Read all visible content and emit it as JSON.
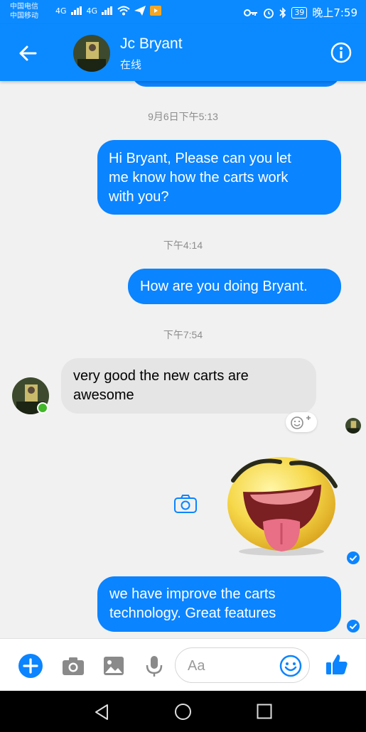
{
  "status_bar": {
    "carrier_1": "中国电信",
    "carrier_2": "中国移动",
    "signal_1": "4G",
    "signal_2": "4G",
    "battery": "39",
    "time": "晚上7:59"
  },
  "header": {
    "contact_name": "Jc Bryant",
    "status": "在线"
  },
  "messages": {
    "ts_1": "9月6日下午5:13",
    "m1_line1": "Hi Bryant, Please can you let",
    "m1_line2": "me know how the carts work",
    "m1_line3": "with you?",
    "ts_2": "下午4:14",
    "m2": "How are you doing Bryant.",
    "ts_3": "下午7:54",
    "m3_line1": "very good the new carts are",
    "m3_line2": "awesome",
    "m4_line1": "we have improve the carts",
    "m4_line2": "technology. Great features"
  },
  "composer": {
    "placeholder": "Aa"
  },
  "colors": {
    "accent": "#0b84ff",
    "incoming_bubble": "#e5e5e5",
    "online": "#42b72a"
  },
  "icons": [
    "back-arrow-icon",
    "info-icon",
    "camera-icon",
    "smiley-plus-icon",
    "check-icon",
    "plus-icon",
    "image-icon",
    "microphone-icon",
    "emoji-icon",
    "thumbs-up-icon",
    "nav-back-icon",
    "nav-home-icon",
    "nav-recents-icon"
  ]
}
